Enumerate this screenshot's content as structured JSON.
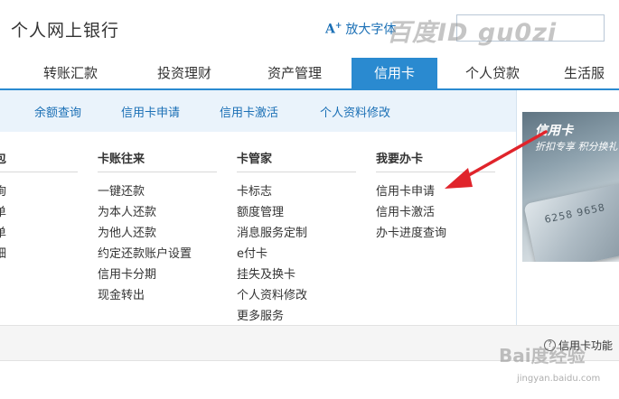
{
  "header": {
    "title": "个人网上银行",
    "font_button_label": "放大字体",
    "font_button_icon": "A+",
    "watermark": "百度ID gu0zi"
  },
  "mainnav": {
    "tabs": [
      {
        "label": "转账汇款",
        "active": false
      },
      {
        "label": "投资理财",
        "active": false
      },
      {
        "label": "资产管理",
        "active": false
      },
      {
        "label": "信用卡",
        "active": true
      },
      {
        "label": "个人贷款",
        "active": false
      },
      {
        "label": "生活服"
      }
    ]
  },
  "subnav": {
    "items": [
      "余额查询",
      "信用卡申请",
      "信用卡激活",
      "个人资料修改"
    ]
  },
  "menu": {
    "col0": {
      "heading": "包",
      "links": [
        "询",
        "单",
        "单",
        "细"
      ]
    },
    "col1": {
      "heading": "卡账往来",
      "links": [
        "一键还款",
        "为本人还款",
        "为他人还款",
        "约定还款账户设置",
        "信用卡分期",
        "现金转出"
      ]
    },
    "col2": {
      "heading": "卡管家",
      "links": [
        "卡标志",
        "额度管理",
        "消息服务定制",
        "e付卡",
        "挂失及换卡",
        "个人资料修改",
        "更多服务"
      ]
    },
    "col3": {
      "heading": "我要办卡",
      "links": [
        "信用卡申请",
        "信用卡激活",
        "办卡进度查询"
      ]
    }
  },
  "promo": {
    "title": "信用卡",
    "subtitle": "折扣专享 积分换礼",
    "card_text": "6258 9658"
  },
  "bottom": {
    "help_label": "信用卡功能",
    "watermark": "Bai度经验",
    "watermark_url": "jingyan.baidu.com"
  },
  "colors": {
    "accent": "#2a8ad0",
    "link": "#1a6fb5",
    "annotation_arrow": "#e0242b"
  }
}
